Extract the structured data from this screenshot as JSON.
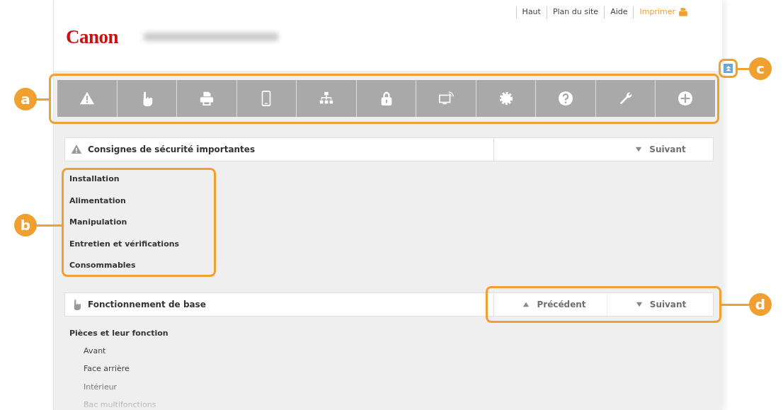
{
  "top_links": [
    {
      "label": "Haut",
      "kind": "link"
    },
    {
      "label": "Plan du site",
      "kind": "link"
    },
    {
      "label": "Aide",
      "kind": "link"
    },
    {
      "label": "Imprimer",
      "kind": "print"
    }
  ],
  "logo": "Canon",
  "toolbar": [
    {
      "kind": "warning"
    },
    {
      "kind": "hand"
    },
    {
      "kind": "printer"
    },
    {
      "kind": "phone"
    },
    {
      "kind": "network"
    },
    {
      "kind": "lock"
    },
    {
      "kind": "wireless"
    },
    {
      "kind": "gear"
    },
    {
      "kind": "help"
    },
    {
      "kind": "wrench"
    },
    {
      "kind": "plus"
    }
  ],
  "sections": [
    {
      "title": "Consignes de sécurité importantes",
      "kind": "warning",
      "nav": [
        {
          "label": "Suivant",
          "kind": "next"
        }
      ],
      "links": [
        {
          "label": "Installation"
        },
        {
          "label": "Alimentation"
        },
        {
          "label": "Manipulation"
        },
        {
          "label": "Entretien et vérifications"
        },
        {
          "label": "Consommables"
        }
      ]
    },
    {
      "title": "Fonctionnement de base",
      "kind": "hand",
      "nav": [
        {
          "label": "Précédent",
          "kind": "prev"
        },
        {
          "label": "Suivant",
          "kind": "next"
        }
      ],
      "links": [
        {
          "label": "Pièces et leur fonction",
          "children": [
            {
              "label": "Avant"
            },
            {
              "label": "Face arrière"
            },
            {
              "label": "Intérieur"
            },
            {
              "label": "Bac multifonctions"
            }
          ]
        }
      ]
    }
  ],
  "callouts": [
    {
      "letter": "a"
    },
    {
      "letter": "b"
    },
    {
      "letter": "c"
    },
    {
      "letter": "d"
    }
  ]
}
